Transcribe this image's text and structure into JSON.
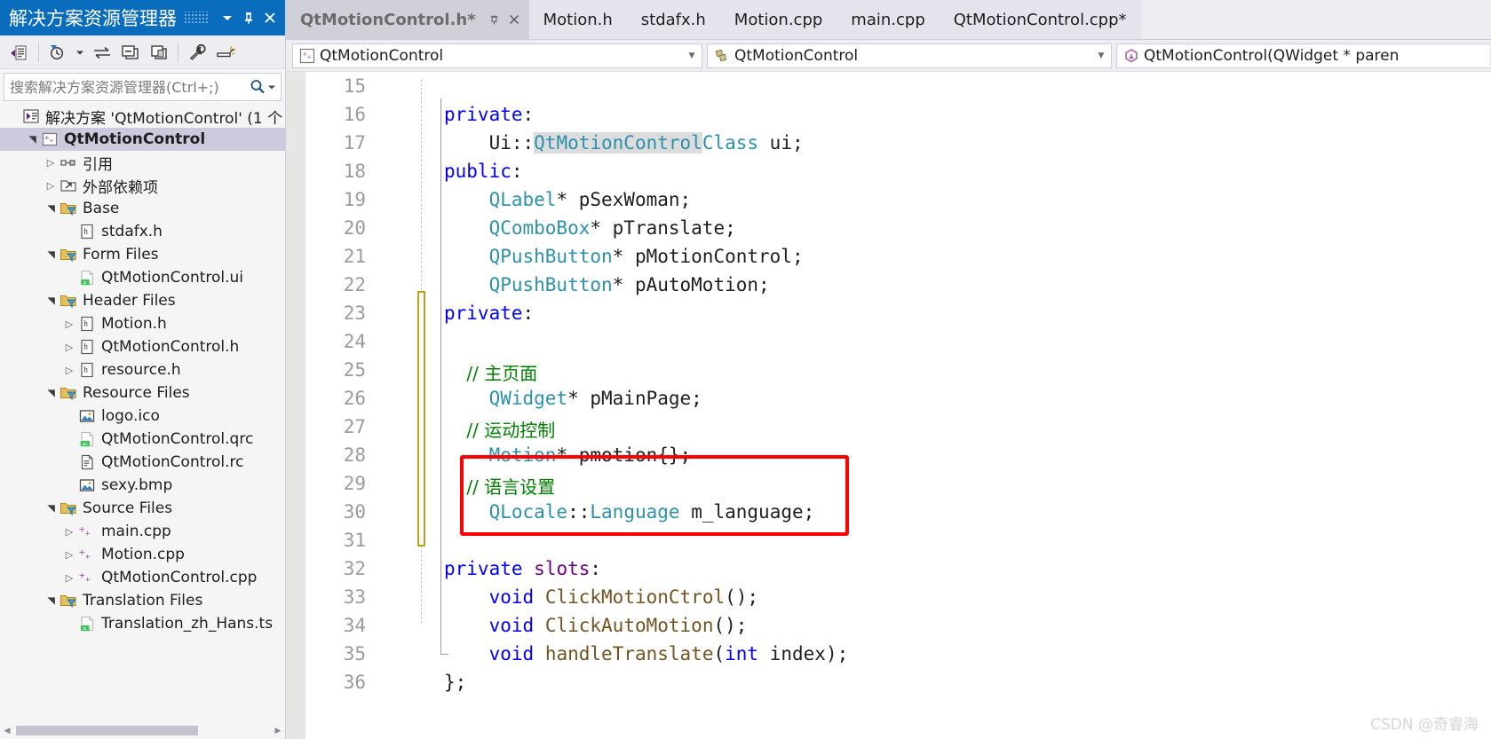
{
  "solution_explorer": {
    "title": "解决方案资源管理器",
    "titlebar_buttons": [
      {
        "name": "dropdown",
        "label": "▼"
      },
      {
        "name": "pin",
        "label": "pin"
      },
      {
        "name": "close",
        "label": "✕"
      }
    ],
    "toolbar": [
      {
        "name": "home-icon",
        "tip": "主页"
      },
      {
        "name": "pending-changes-filter-icon",
        "tip": "挂起的更改筛选器"
      },
      {
        "name": "sync-with-active-document-icon",
        "tip": "与活动文档同步"
      },
      {
        "name": "collapse-all-icon",
        "tip": "全部折叠"
      },
      {
        "name": "show-all-files-icon",
        "tip": "显示所有文件"
      },
      {
        "name": "properties-icon",
        "tip": "属性"
      },
      {
        "name": "preview-selected-items-icon",
        "tip": "预览选定项"
      }
    ],
    "search": {
      "placeholder": "搜索解决方案资源管理器(Ctrl+;)",
      "value": ""
    },
    "tree": [
      {
        "label": "解决方案 'QtMotionControl' (1 个",
        "indent": 0,
        "twisty": "",
        "icon": "solution-icon",
        "selected": false,
        "bold": false
      },
      {
        "label": "QtMotionControl",
        "indent": 1,
        "twisty": "▴",
        "icon": "cpp-project-icon",
        "selected": true,
        "bold": true
      },
      {
        "label": "引用",
        "indent": 2,
        "twisty": "▸",
        "icon": "references-icon",
        "selected": false,
        "bold": false
      },
      {
        "label": "外部依赖项",
        "indent": 2,
        "twisty": "▸",
        "icon": "external-dependencies-icon",
        "selected": false,
        "bold": false
      },
      {
        "label": "Base",
        "indent": 2,
        "twisty": "▴",
        "icon": "filter-folder-icon",
        "selected": false,
        "bold": false
      },
      {
        "label": "stdafx.h",
        "indent": 3,
        "twisty": "",
        "icon": "header-file-icon",
        "selected": false,
        "bold": false
      },
      {
        "label": "Form Files",
        "indent": 2,
        "twisty": "▴",
        "icon": "filter-folder-icon",
        "selected": false,
        "bold": false
      },
      {
        "label": "QtMotionControl.ui",
        "indent": 3,
        "twisty": "",
        "icon": "ui-file-icon",
        "selected": false,
        "bold": false
      },
      {
        "label": "Header Files",
        "indent": 2,
        "twisty": "▴",
        "icon": "filter-folder-icon",
        "selected": false,
        "bold": false
      },
      {
        "label": "Motion.h",
        "indent": 3,
        "twisty": "▸",
        "icon": "header-file-icon",
        "selected": false,
        "bold": false
      },
      {
        "label": "QtMotionControl.h",
        "indent": 3,
        "twisty": "▸",
        "icon": "header-file-icon",
        "selected": false,
        "bold": false
      },
      {
        "label": "resource.h",
        "indent": 3,
        "twisty": "▸",
        "icon": "header-file-icon",
        "selected": false,
        "bold": false
      },
      {
        "label": "Resource Files",
        "indent": 2,
        "twisty": "▴",
        "icon": "filter-folder-icon",
        "selected": false,
        "bold": false
      },
      {
        "label": "logo.ico",
        "indent": 3,
        "twisty": "",
        "icon": "image-file-icon",
        "selected": false,
        "bold": false
      },
      {
        "label": "QtMotionControl.qrc",
        "indent": 3,
        "twisty": "",
        "icon": "qrc-file-icon",
        "selected": false,
        "bold": false
      },
      {
        "label": "QtMotionControl.rc",
        "indent": 3,
        "twisty": "",
        "icon": "rc-file-icon",
        "selected": false,
        "bold": false
      },
      {
        "label": "sexy.bmp",
        "indent": 3,
        "twisty": "",
        "icon": "image-file-icon",
        "selected": false,
        "bold": false
      },
      {
        "label": "Source Files",
        "indent": 2,
        "twisty": "▴",
        "icon": "filter-folder-icon",
        "selected": false,
        "bold": false
      },
      {
        "label": "main.cpp",
        "indent": 3,
        "twisty": "▸",
        "icon": "cpp-file-icon",
        "selected": false,
        "bold": false
      },
      {
        "label": "Motion.cpp",
        "indent": 3,
        "twisty": "▸",
        "icon": "cpp-file-icon",
        "selected": false,
        "bold": false
      },
      {
        "label": "QtMotionControl.cpp",
        "indent": 3,
        "twisty": "▸",
        "icon": "cpp-file-icon",
        "selected": false,
        "bold": false
      },
      {
        "label": "Translation Files",
        "indent": 2,
        "twisty": "▴",
        "icon": "filter-folder-icon",
        "selected": false,
        "bold": false
      },
      {
        "label": "Translation_zh_Hans.ts",
        "indent": 3,
        "twisty": "",
        "icon": "ts-file-icon",
        "selected": false,
        "bold": false
      }
    ]
  },
  "editor": {
    "tabs": [
      {
        "label": "QtMotionControl.h*",
        "active": true
      },
      {
        "label": "Motion.h",
        "active": false
      },
      {
        "label": "stdafx.h",
        "active": false
      },
      {
        "label": "Motion.cpp",
        "active": false
      },
      {
        "label": "main.cpp",
        "active": false
      },
      {
        "label": "QtMotionControl.cpp*",
        "active": false
      }
    ],
    "navbar": {
      "project": "QtMotionControl",
      "class": "QtMotionControl",
      "member": "QtMotionControl(QWidget * paren"
    },
    "first_line_number": 15,
    "lines": [
      {
        "n": 15,
        "tokens": []
      },
      {
        "n": 16,
        "tokens": [
          {
            "t": "private",
            "c": "kw"
          },
          {
            "t": ":",
            "c": "pln"
          }
        ]
      },
      {
        "n": 17,
        "tokens": [
          {
            "t": "    Ui",
            "c": "pln"
          },
          {
            "t": "::",
            "c": "pln"
          },
          {
            "t": "QtMotionControl",
            "c": "typ hl"
          },
          {
            "t": "Class",
            "c": "typ"
          },
          {
            "t": " ui;",
            "c": "pln"
          }
        ]
      },
      {
        "n": 18,
        "tokens": [
          {
            "t": "public",
            "c": "kw"
          },
          {
            "t": ":",
            "c": "pln"
          }
        ]
      },
      {
        "n": 19,
        "tokens": [
          {
            "t": "    ",
            "c": "pln"
          },
          {
            "t": "QLabel",
            "c": "typ"
          },
          {
            "t": "* pSexWoman;",
            "c": "pln"
          }
        ]
      },
      {
        "n": 20,
        "tokens": [
          {
            "t": "    ",
            "c": "pln"
          },
          {
            "t": "QComboBox",
            "c": "typ"
          },
          {
            "t": "* pTranslate;",
            "c": "pln"
          }
        ]
      },
      {
        "n": 21,
        "tokens": [
          {
            "t": "    ",
            "c": "pln"
          },
          {
            "t": "QPushButton",
            "c": "typ"
          },
          {
            "t": "* pMotionControl;",
            "c": "pln"
          }
        ]
      },
      {
        "n": 22,
        "tokens": [
          {
            "t": "    ",
            "c": "pln"
          },
          {
            "t": "QPushButton",
            "c": "typ"
          },
          {
            "t": "* pAutoMotion;",
            "c": "pln"
          }
        ]
      },
      {
        "n": 23,
        "tokens": [
          {
            "t": "private",
            "c": "kw"
          },
          {
            "t": ":",
            "c": "pln"
          }
        ]
      },
      {
        "n": 24,
        "tokens": []
      },
      {
        "n": 25,
        "tokens": [
          {
            "t": "    // 主页面",
            "c": "cmt"
          }
        ]
      },
      {
        "n": 26,
        "tokens": [
          {
            "t": "    ",
            "c": "pln"
          },
          {
            "t": "QWidget",
            "c": "typ"
          },
          {
            "t": "* pMainPage;",
            "c": "pln"
          }
        ]
      },
      {
        "n": 27,
        "tokens": [
          {
            "t": "    // 运动控制",
            "c": "cmt"
          }
        ]
      },
      {
        "n": 28,
        "tokens": [
          {
            "t": "    ",
            "c": "pln"
          },
          {
            "t": "Motion",
            "c": "typ"
          },
          {
            "t": "* pmotion{};",
            "c": "pln"
          }
        ]
      },
      {
        "n": 29,
        "tokens": [
          {
            "t": "    // 语言设置",
            "c": "cmt"
          }
        ]
      },
      {
        "n": 30,
        "tokens": [
          {
            "t": "    ",
            "c": "pln"
          },
          {
            "t": "QLocale",
            "c": "typ"
          },
          {
            "t": "::",
            "c": "pln"
          },
          {
            "t": "Language",
            "c": "typ"
          },
          {
            "t": " m_language;",
            "c": "pln"
          }
        ]
      },
      {
        "n": 31,
        "tokens": []
      },
      {
        "n": 32,
        "tokens": [
          {
            "t": "private",
            "c": "kw"
          },
          {
            "t": " ",
            "c": "pln"
          },
          {
            "t": "slots",
            "c": "pp"
          },
          {
            "t": ":",
            "c": "pln"
          }
        ]
      },
      {
        "n": 33,
        "tokens": [
          {
            "t": "    ",
            "c": "pln"
          },
          {
            "t": "void",
            "c": "kw"
          },
          {
            "t": " ",
            "c": "pln"
          },
          {
            "t": "ClickMotionCtrol",
            "c": "fn"
          },
          {
            "t": "();",
            "c": "pln"
          }
        ]
      },
      {
        "n": 34,
        "tokens": [
          {
            "t": "    ",
            "c": "pln"
          },
          {
            "t": "void",
            "c": "kw"
          },
          {
            "t": " ",
            "c": "pln"
          },
          {
            "t": "ClickAutoMotion",
            "c": "fn"
          },
          {
            "t": "();",
            "c": "pln"
          }
        ]
      },
      {
        "n": 35,
        "tokens": [
          {
            "t": "    ",
            "c": "pln"
          },
          {
            "t": "void",
            "c": "kw"
          },
          {
            "t": " ",
            "c": "pln"
          },
          {
            "t": "handleTranslate",
            "c": "fn"
          },
          {
            "t": "(",
            "c": "pln"
          },
          {
            "t": "int",
            "c": "kw"
          },
          {
            "t": " ",
            "c": "pln"
          },
          {
            "t": "index",
            "c": "pln"
          },
          {
            "t": ");",
            "c": "pln"
          }
        ]
      },
      {
        "n": 36,
        "tokens": [
          {
            "t": "};",
            "c": "pln"
          }
        ]
      }
    ],
    "annotation": {
      "type": "red-rectangle",
      "color": "#ff0000",
      "covers_lines": [
        29,
        30
      ]
    },
    "change_bar": {
      "color": "#c0a01a",
      "covers_lines": [
        23,
        31
      ]
    }
  },
  "watermark": "CSDN @奇睿海",
  "colors": {
    "titlebar": "#0a6cbc",
    "panel_bg": "#f5f5f5",
    "toolbar_bg": "#eeeef2",
    "selection": "#cbcbdd",
    "accent_red": "#ff0000",
    "change_yellow": "#c0a01a",
    "keyword_blue": "#0000ff",
    "type_teal": "#2b91af",
    "comment_green": "#008000",
    "function_brown": "#74531f",
    "macro_purple": "#6f008a"
  }
}
